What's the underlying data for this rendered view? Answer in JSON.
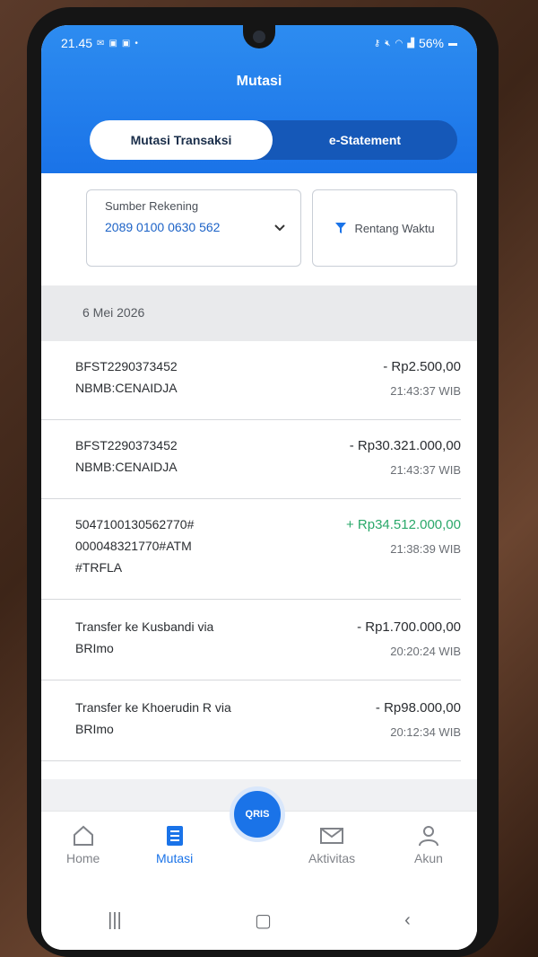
{
  "status_bar": {
    "time": "21.45",
    "left_icons": [
      "mail-icon",
      "sim-icon",
      "sim-icon",
      "dot-icon"
    ],
    "battery": "56%"
  },
  "header": {
    "title": "Mutasi"
  },
  "tabs": [
    {
      "label": "Mutasi Transaksi",
      "active": true
    },
    {
      "label": "e-Statement",
      "active": false
    }
  ],
  "filters": {
    "source_label": "Sumber Rekening",
    "source_value": "2089 0100 0630 562",
    "range_label": "Rentang Waktu"
  },
  "date_header": "6 Mei 2026",
  "transactions": [
    {
      "desc_lines": [
        "BFST2290373452",
        "NBMB:CENAIDJA"
      ],
      "amount": "- Rp2.500,00",
      "time": "21:43:37 WIB",
      "type": "debit"
    },
    {
      "desc_lines": [
        "BFST2290373452",
        "NBMB:CENAIDJA"
      ],
      "amount": "- Rp30.321.000,00",
      "time": "21:43:37 WIB",
      "type": "debit"
    },
    {
      "desc_lines": [
        "5047100130562770#",
        "000048321770#ATM",
        "#TRFLA"
      ],
      "amount": "+ Rp34.512.000,00",
      "time": "21:38:39 WIB",
      "type": "credit"
    },
    {
      "desc_lines": [
        "Transfer ke Kusbandi via",
        "BRImo"
      ],
      "amount": "- Rp1.700.000,00",
      "time": "20:20:24 WIB",
      "type": "debit"
    },
    {
      "desc_lines": [
        "Transfer ke Khoerudin R via",
        "BRImo"
      ],
      "amount": "- Rp98.000,00",
      "time": "20:12:34 WIB",
      "type": "debit"
    }
  ],
  "nav": [
    {
      "label": "Home",
      "icon": "home-icon",
      "active": false
    },
    {
      "label": "Mutasi",
      "icon": "document-list-icon",
      "active": true
    },
    {
      "label": "Aktivitas",
      "icon": "envelope-icon",
      "active": false
    },
    {
      "label": "Akun",
      "icon": "person-icon",
      "active": false
    }
  ],
  "qris_label": "QRIS",
  "colors": {
    "primary": "#1a73e8",
    "credit": "#2aa86a",
    "tab_track": "#1558b8"
  }
}
